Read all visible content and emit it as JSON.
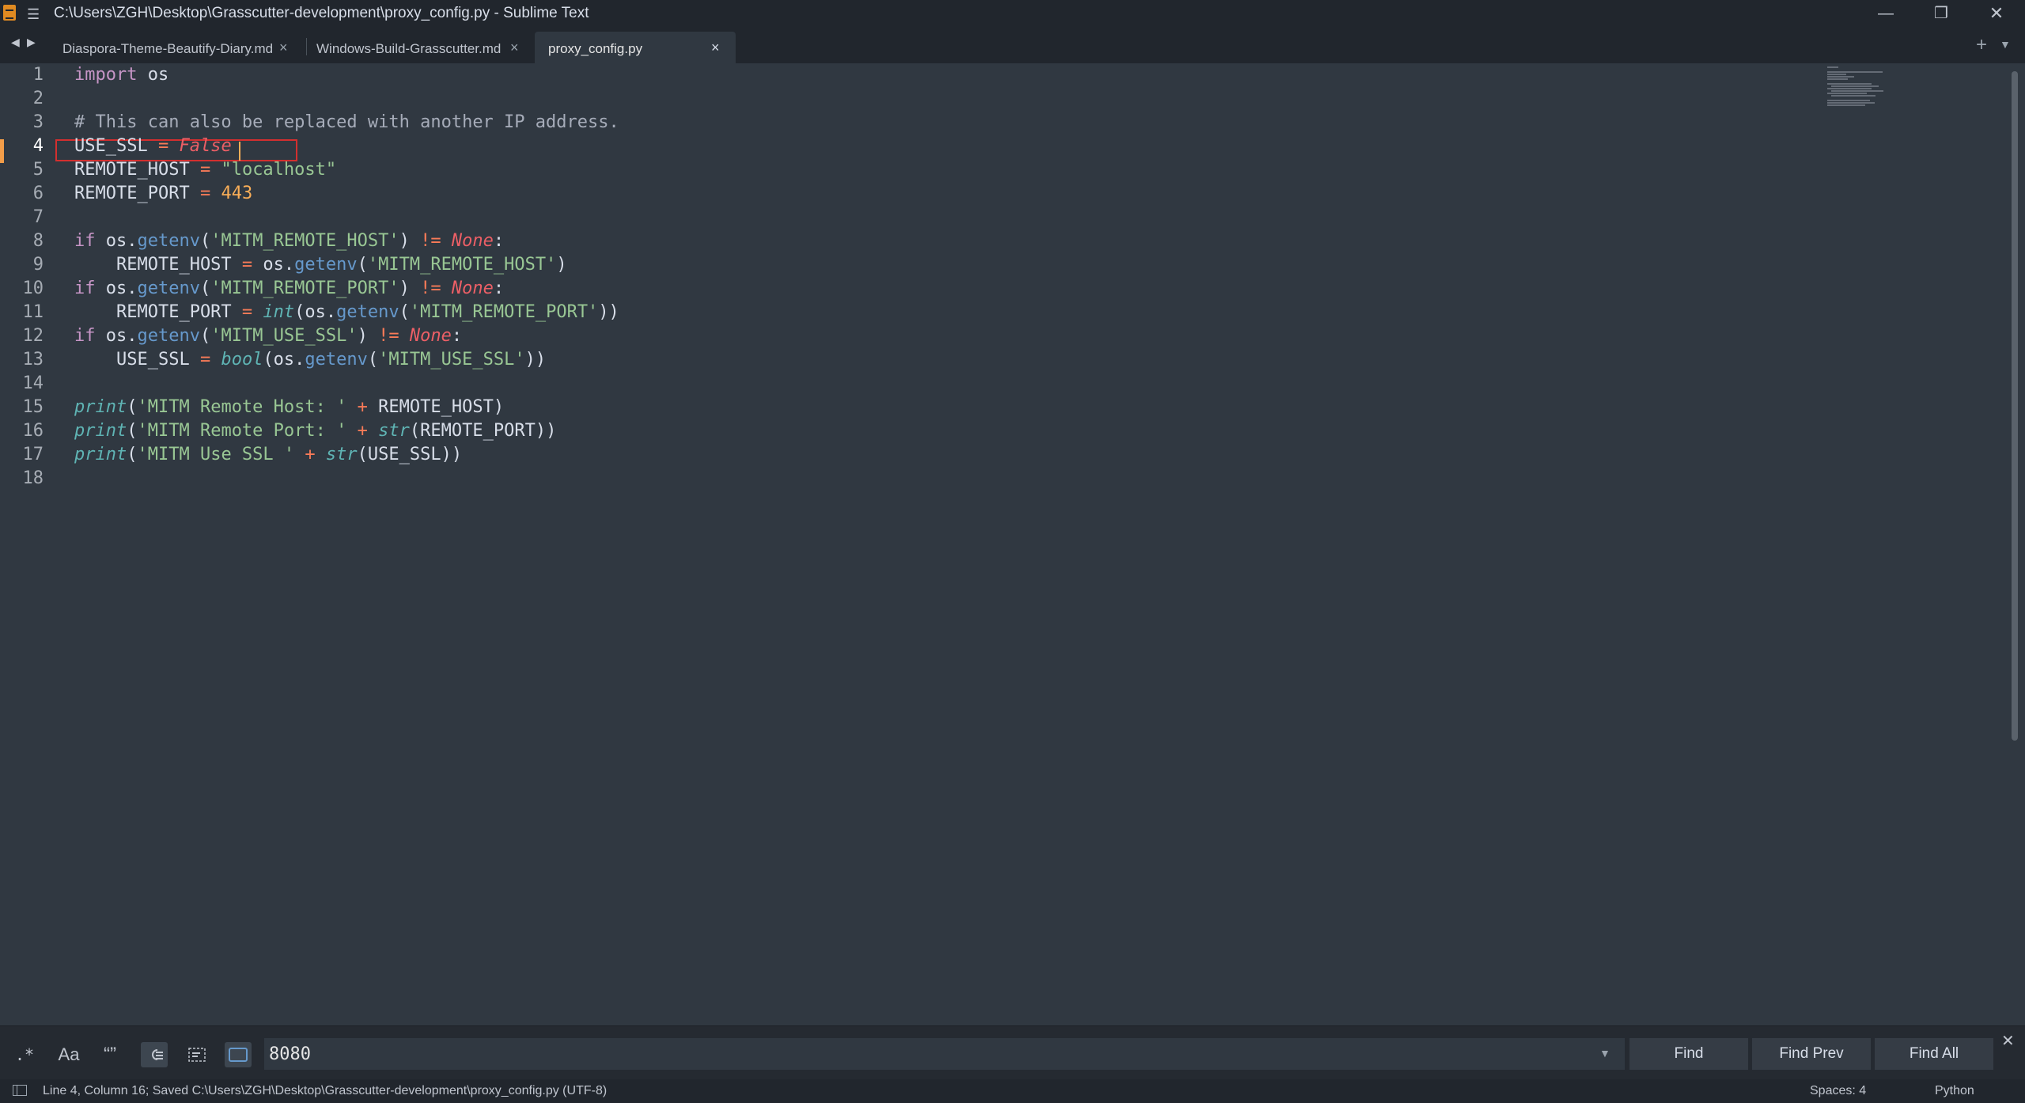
{
  "window": {
    "title": "C:\\Users\\ZGH\\Desktop\\Grasscutter-development\\proxy_config.py - Sublime Text",
    "menu_icon": "hamburger-icon",
    "app_icon": "sublime-text-icon",
    "minimize_glyph": "—",
    "restore_glyph": "❐",
    "close_glyph": "✕"
  },
  "tabs": [
    {
      "label": "Diaspora-Theme-Beautify-Diary.md",
      "active": false
    },
    {
      "label": "Windows-Build-Grasscutter.md",
      "active": false
    },
    {
      "label": "proxy_config.py",
      "active": true
    }
  ],
  "editor": {
    "line_numbers": [
      "1",
      "2",
      "3",
      "4",
      "5",
      "6",
      "7",
      "8",
      "9",
      "10",
      "11",
      "12",
      "13",
      "14",
      "15",
      "16",
      "17",
      "18"
    ],
    "active_line": 4,
    "code_lines": [
      "import os",
      "",
      "# This can also be replaced with another IP address.",
      "USE_SSL = False",
      "REMOTE_HOST = \"localhost\"",
      "REMOTE_PORT = 443",
      "",
      "if os.getenv('MITM_REMOTE_HOST') != None:",
      "    REMOTE_HOST = os.getenv('MITM_REMOTE_HOST')",
      "if os.getenv('MITM_REMOTE_PORT') != None:",
      "    REMOTE_PORT = int(os.getenv('MITM_REMOTE_PORT'))",
      "if os.getenv('MITM_USE_SSL') != None:",
      "    USE_SSL = bool(os.getenv('MITM_USE_SSL'))",
      "",
      "print('MITM Remote Host: ' + REMOTE_HOST)",
      "print('MITM Remote Port: ' + str(REMOTE_PORT))",
      "print('MITM Use SSL ' + str(USE_SSL))",
      ""
    ]
  },
  "find_panel": {
    "options": {
      "regex": ".*",
      "case_sensitive": "Aa",
      "whole_word": "“”",
      "wrap_icon": "wrap-icon",
      "in_selection_icon": "in-selection-icon",
      "highlight_icon": "highlight-matches-icon"
    },
    "query": "8080",
    "buttons": {
      "find": "Find",
      "find_prev": "Find Prev",
      "find_all": "Find All"
    }
  },
  "status_bar": {
    "text": "Line 4, Column 16; Saved C:\\Users\\ZGH\\Desktop\\Grasscutter-development\\proxy_config.py (UTF-8)",
    "indentation": "Spaces: 4",
    "syntax": "Python"
  },
  "colors": {
    "background": "#303841",
    "chrome": "#21262d",
    "accent": "#f29d49",
    "highlight_box": "#d32f2f"
  }
}
